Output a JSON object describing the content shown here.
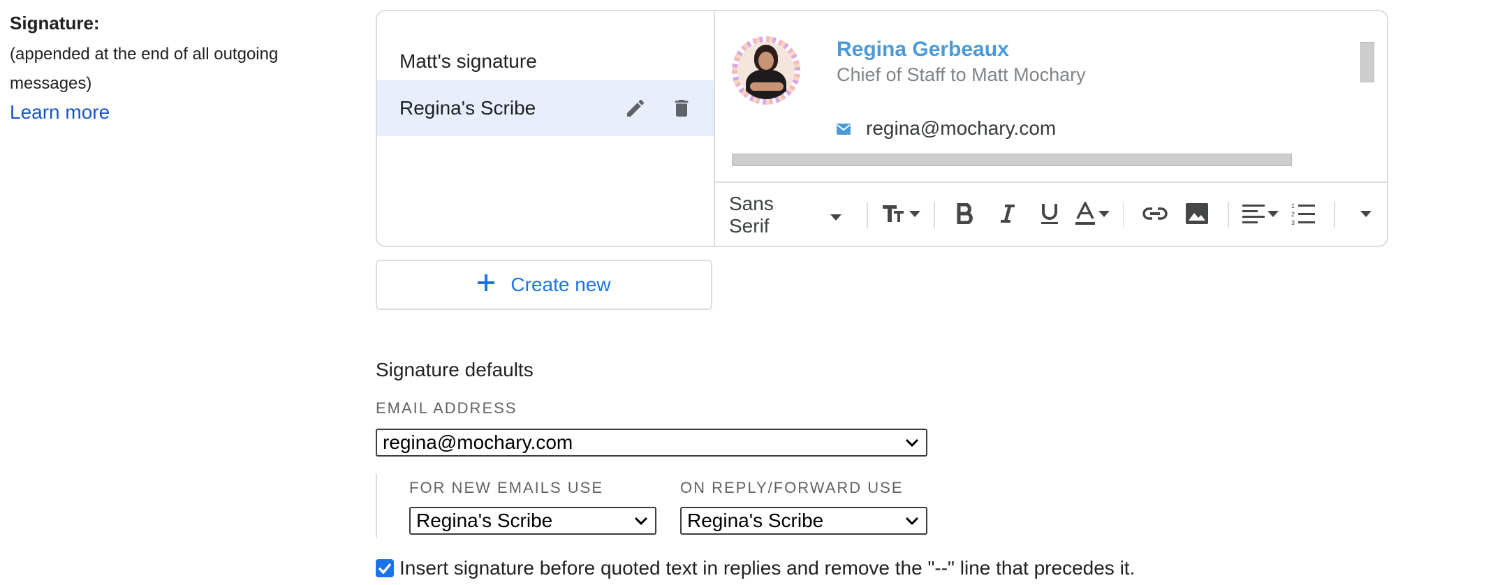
{
  "signature_section": {
    "heading": "Signature:",
    "description": "(appended at the end of all outgoing messages)",
    "learn_more": "Learn more"
  },
  "signatures": [
    {
      "label": "Matt's signature",
      "selected": false
    },
    {
      "label": "Regina's Scribe",
      "selected": true
    }
  ],
  "preview": {
    "name": "Regina Gerbeaux",
    "title": "Chief of Staff to Matt Mochary",
    "email": "regina@mochary.com"
  },
  "toolbar": {
    "font_name": "Sans Serif",
    "icons": [
      "text-size-icon",
      "bold-icon",
      "italic-icon",
      "underline-icon",
      "text-color-icon",
      "link-icon",
      "image-icon",
      "align-icon",
      "numbered-list-icon",
      "more-options-icon"
    ]
  },
  "create_new": {
    "label": "Create new"
  },
  "defaults": {
    "title": "Signature defaults",
    "email_label": "EMAIL ADDRESS",
    "email_value": "regina@mochary.com",
    "new_emails_label": "FOR NEW EMAILS USE",
    "new_emails_value": "Regina's Scribe",
    "reply_label": "ON REPLY/FORWARD USE",
    "reply_value": "Regina's Scribe"
  },
  "insert_option": {
    "checked": true,
    "label": "Insert signature before quoted text in replies and remove the \"--\" line that precedes it."
  },
  "colors": {
    "accent": "#1a73e8",
    "link": "#1a56c6",
    "preview_name": "#4a9ad8",
    "selected_row": "#e8eefc",
    "border": "#dadce0"
  }
}
